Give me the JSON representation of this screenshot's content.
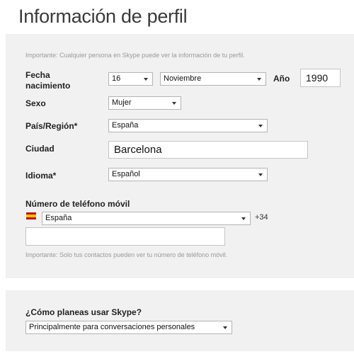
{
  "page_title": "Información de perfil",
  "profile": {
    "note": "Importante: Cualquier persona en Skype puede ver la información de tu perfil.",
    "birth_label": "Fecha nacimiento",
    "day_value": "16",
    "month_value": "Noviembre",
    "year_label": "Año",
    "year_value": "1990",
    "gender_label": "Sexo",
    "gender_value": "Mujer",
    "country_label": "País/Región*",
    "country_value": "España",
    "city_label": "Ciudad",
    "city_value": "Barcelona",
    "language_label": "Idioma*",
    "language_value": "Español"
  },
  "phone": {
    "label": "Número de teléfono móvil",
    "country_value": "España",
    "prefix": "+34",
    "number_value": "",
    "note": "Importante: Solo tus contactos pueden ver tu número de teléfono móvil.",
    "flag_icon": "spain-flag-icon"
  },
  "usage": {
    "label": "¿Cómo planeas usar Skype?",
    "value": "Principalmente para conversaciones personales"
  },
  "colors": {
    "panel_bg": "#f1f1f1",
    "note_text": "#999999",
    "field_border": "#b4b4b4"
  }
}
